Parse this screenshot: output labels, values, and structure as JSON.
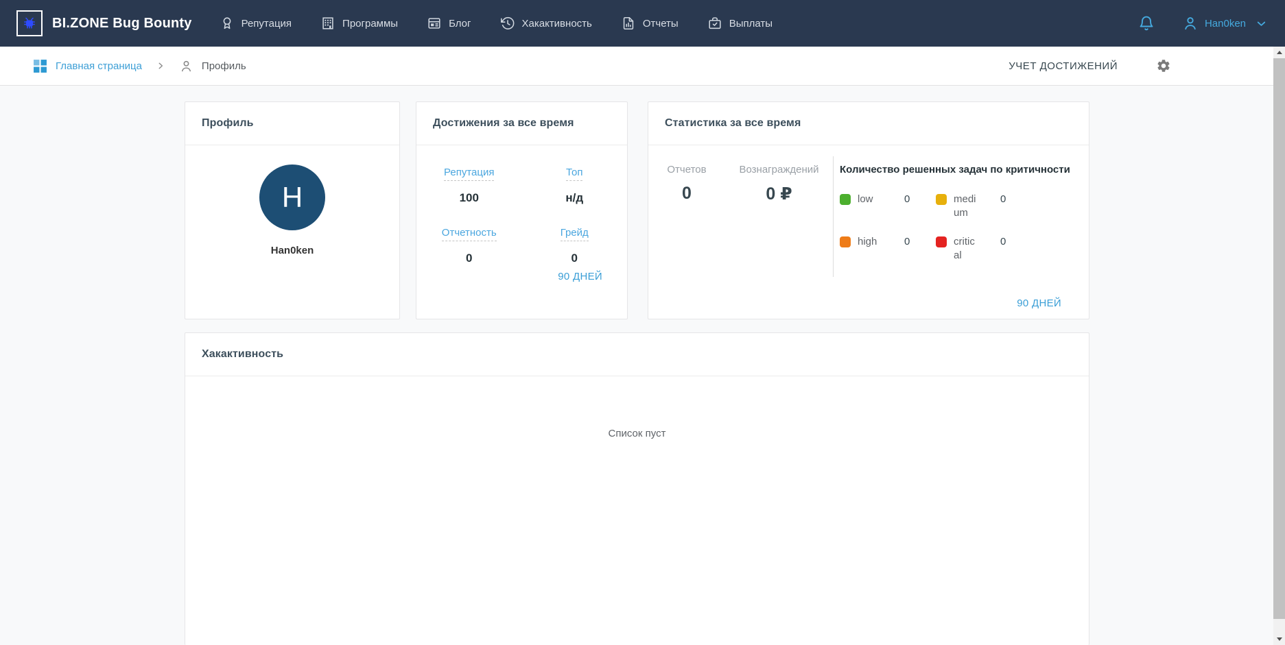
{
  "navbar": {
    "brand": "BI.ZONE Bug Bounty",
    "items": [
      {
        "label": "Репутация",
        "icon": "medal-icon"
      },
      {
        "label": "Программы",
        "icon": "building-icon"
      },
      {
        "label": "Блог",
        "icon": "blog-icon"
      },
      {
        "label": "Хакактивность",
        "icon": "history-icon"
      },
      {
        "label": "Отчеты",
        "icon": "report-icon"
      },
      {
        "label": "Выплаты",
        "icon": "briefcase-icon"
      }
    ],
    "username": "Han0ken"
  },
  "breadcrumb": {
    "home": "Главная страница",
    "current": "Профиль",
    "achievements_link": "УЧЕТ ДОСТИЖЕНИЙ"
  },
  "profile_card": {
    "title": "Профиль",
    "avatar_letter": "H",
    "username": "Han0ken"
  },
  "achievements_card": {
    "title": "Достижения за все время",
    "stats": [
      {
        "label": "Репутация",
        "value": "100"
      },
      {
        "label": "Топ",
        "value": "н/д"
      },
      {
        "label": "Отчетность",
        "value": "0"
      },
      {
        "label": "Грейд",
        "value": "0"
      }
    ],
    "period_link": "90 ДНЕЙ"
  },
  "statistics_card": {
    "title": "Статистика за все время",
    "reports_label": "Отчетов",
    "reports_value": "0",
    "rewards_label": "Вознаграждений",
    "rewards_value": "0 ₽",
    "severity_title": "Количество решенных задач по критичности",
    "severity_items": [
      {
        "label": "low",
        "count": "0",
        "color": "#4caf2e"
      },
      {
        "label": "medium",
        "count": "0",
        "color": "#e7b00c"
      },
      {
        "label": "high",
        "count": "0",
        "color": "#ee7c18"
      },
      {
        "label": "critical",
        "count": "0",
        "color": "#e42321"
      }
    ],
    "period_link": "90 ДНЕЙ"
  },
  "activity_card": {
    "title": "Хакактивность",
    "empty_text": "Список пуст"
  },
  "colors": {
    "navbar_bg": "#2a3950",
    "accent_blue": "#3fa2da",
    "avatar_bg": "#1d4e74"
  }
}
